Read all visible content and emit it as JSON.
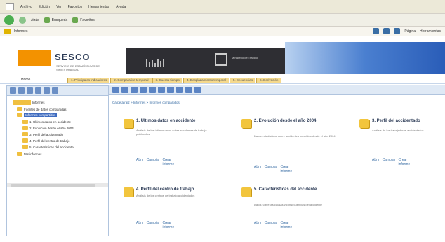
{
  "browser": {
    "menu": [
      "Archivo",
      "Edición",
      "Ver",
      "Favoritos",
      "Herramientas",
      "Ayuda"
    ],
    "toolbar_items": [
      "Atrás",
      "Búsqueda",
      "Favoritos"
    ],
    "address": "Informes",
    "page_menu": "Página",
    "tools_menu": "Herramientas"
  },
  "header": {
    "logo_text": "SESCO",
    "logo_subtitle": "SERVICIO DE ESTADÍSTICAS DE SINIESTRALIDAD",
    "partner_text": "Ministerio de Trabajo"
  },
  "nav": {
    "home": "Home",
    "items": [
      "1. Principales indicadores",
      "2. Comparativa temporal",
      "3. Cuenta tiempo",
      "4. Desplazamiento temporal",
      "5. Secuencias",
      "6. Derivación"
    ]
  },
  "tree": {
    "root": "Informes",
    "items": [
      "Fuentes de datos compartidas",
      "Informes compartidos",
      "1. Últimos datos en accidente",
      "2. Evolución desde el año 2004",
      "3. Perfil del accidentado",
      "4. Perfil del centro de trabajo",
      "5. Características del accidente",
      "Mis informes"
    ]
  },
  "breadcrumb": "Carpeta raíz > Informes > Informes compartidos",
  "reports": [
    {
      "title": "1. Últimos datos en accidente",
      "desc": "Análisis de los últimos datos sobre accidentes de trabajo publicados",
      "links": [
        "Abrir",
        "Cambiar",
        "Crear informe"
      ]
    },
    {
      "title": "2. Evolución desde el año 2004",
      "desc": "Datos estadísticos sobre accidentes ocurridos desde el año 2004",
      "links": [
        "Abrir",
        "Cambiar",
        "Crear informe"
      ]
    },
    {
      "title": "3. Perfil del accidentado",
      "desc": "Análisis de los trabajadores accidentados",
      "links": [
        "Abrir",
        "Cambiar",
        "Crear informe"
      ]
    },
    {
      "title": "4. Perfil del centro de trabajo",
      "desc": "Análisis de los centros de trabajo accidentados",
      "links": [
        "Abrir",
        "Cambiar",
        "Crear informe"
      ]
    },
    {
      "title": "5. Características del accidente",
      "desc": "Datos sobre las causas y consecuencias del accidente",
      "links": [
        "Abrir",
        "Cambiar",
        "Crear informe"
      ]
    }
  ],
  "colors": {
    "accent_orange": "#f39200",
    "nav_tab": "#f5d98c",
    "banner_dark": "#2e2e33",
    "link": "#3a6ea5"
  }
}
